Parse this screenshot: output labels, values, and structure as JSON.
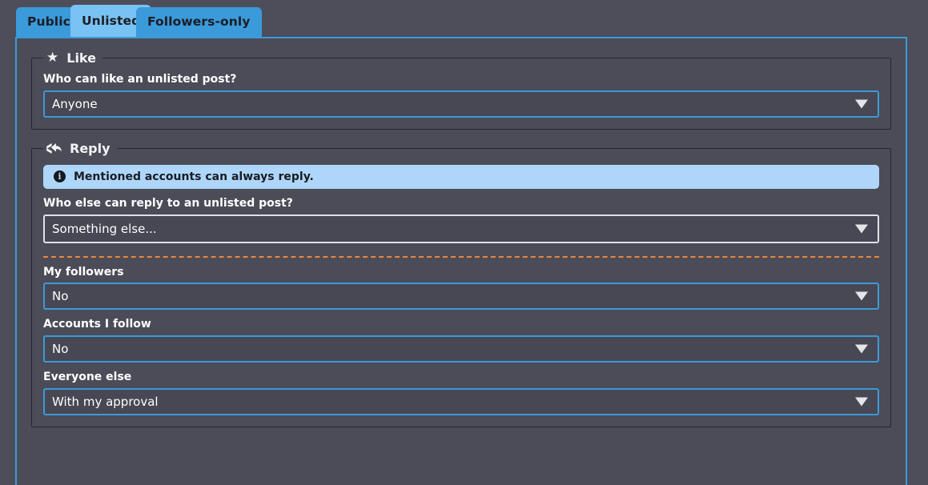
{
  "tabs": [
    {
      "label": "Public",
      "active": false
    },
    {
      "label": "Unlisted",
      "active": true
    },
    {
      "label": "Followers-only",
      "active": false
    }
  ],
  "colors": {
    "accent_blue": "#3b9ada",
    "active_tab_blue": "#79c2f4",
    "banner_blue": "#aed6fa",
    "divider_orange": "#e8883a",
    "panel_bg": "#4b4c57",
    "page_bg": "#4d4e59",
    "fieldset_border": "#25262d",
    "focus_border": "#dfe1e6"
  },
  "like_section": {
    "legend": "Like",
    "legend_icon": "star-icon",
    "question_label": "Who can like an unlisted post?",
    "select_value": "Anyone"
  },
  "reply_section": {
    "legend": "Reply",
    "legend_icon": "reply-all-icon",
    "banner": {
      "icon": "info-circle-icon",
      "icon_glyph": "i",
      "text": "Mentioned accounts can always reply."
    },
    "question_label": "Who else can reply to an unlisted post?",
    "question_value": "Something else...",
    "rows": [
      {
        "label": "My followers",
        "value": "No"
      },
      {
        "label": "Accounts I follow",
        "value": "No"
      },
      {
        "label": "Everyone else",
        "value": "With my approval"
      }
    ]
  }
}
